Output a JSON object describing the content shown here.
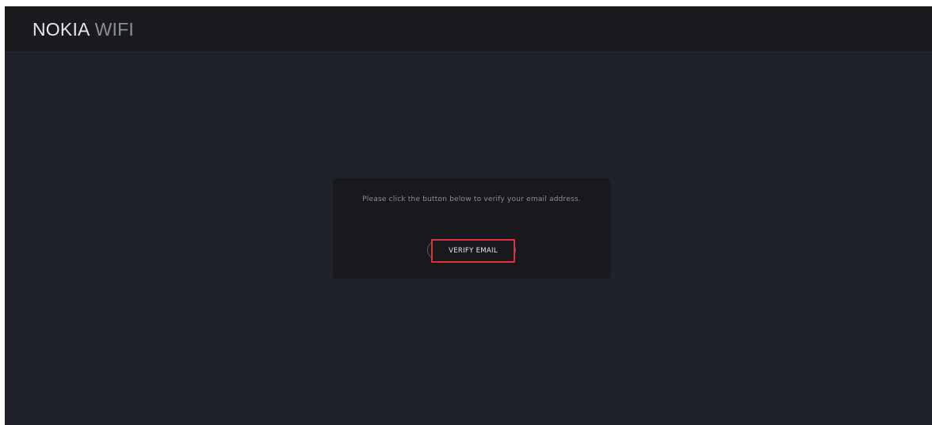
{
  "header": {
    "logo_primary": "NOKIA",
    "logo_secondary": "WIFI"
  },
  "verify": {
    "message": "Please click the button below to verify your email address.",
    "button_label": "VERIFY EMAIL"
  },
  "colors": {
    "page_background": "#1f222a",
    "header_background": "#1a1b1f",
    "card_background": "#18191d",
    "highlight_border": "#d8343a"
  }
}
